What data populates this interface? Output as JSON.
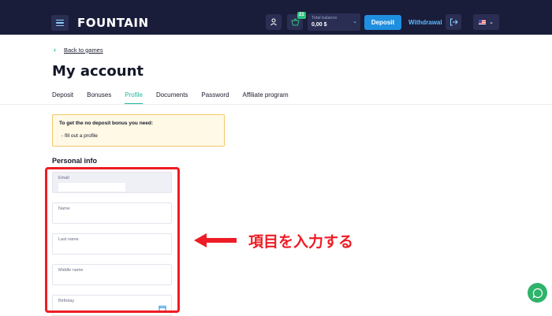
{
  "header": {
    "logo": "FOUNTAIN",
    "gift_badge": "21",
    "balance_label": "Total balance",
    "balance_value": "0,00 $",
    "deposit_label": "Deposit",
    "withdrawal_label": "Withdrawal"
  },
  "nav": {
    "back_label": "Back to games"
  },
  "page": {
    "title": "My account",
    "tabs": [
      {
        "label": "Deposit",
        "active": false
      },
      {
        "label": "Bonuses",
        "active": false
      },
      {
        "label": "Profile",
        "active": true
      },
      {
        "label": "Documents",
        "active": false
      },
      {
        "label": "Password",
        "active": false
      },
      {
        "label": "Affiliate program",
        "active": false
      }
    ]
  },
  "notice": {
    "title": "To get the no deposit bonus you need:",
    "item": "- fill out a profile"
  },
  "personal_info": {
    "section_title": "Personal info",
    "fields": [
      {
        "label": "Email"
      },
      {
        "label": "Name"
      },
      {
        "label": "Last name"
      },
      {
        "label": "Middle name"
      },
      {
        "label": "Birthday"
      }
    ]
  },
  "annotation": {
    "text": "項目を入力する",
    "color": "#ee1c25"
  },
  "colors": {
    "accent": "#1fb8a0",
    "topbar": "#1a1d3a",
    "deposit_button": "#1f8fe0",
    "chat_button": "#2fb36a"
  }
}
